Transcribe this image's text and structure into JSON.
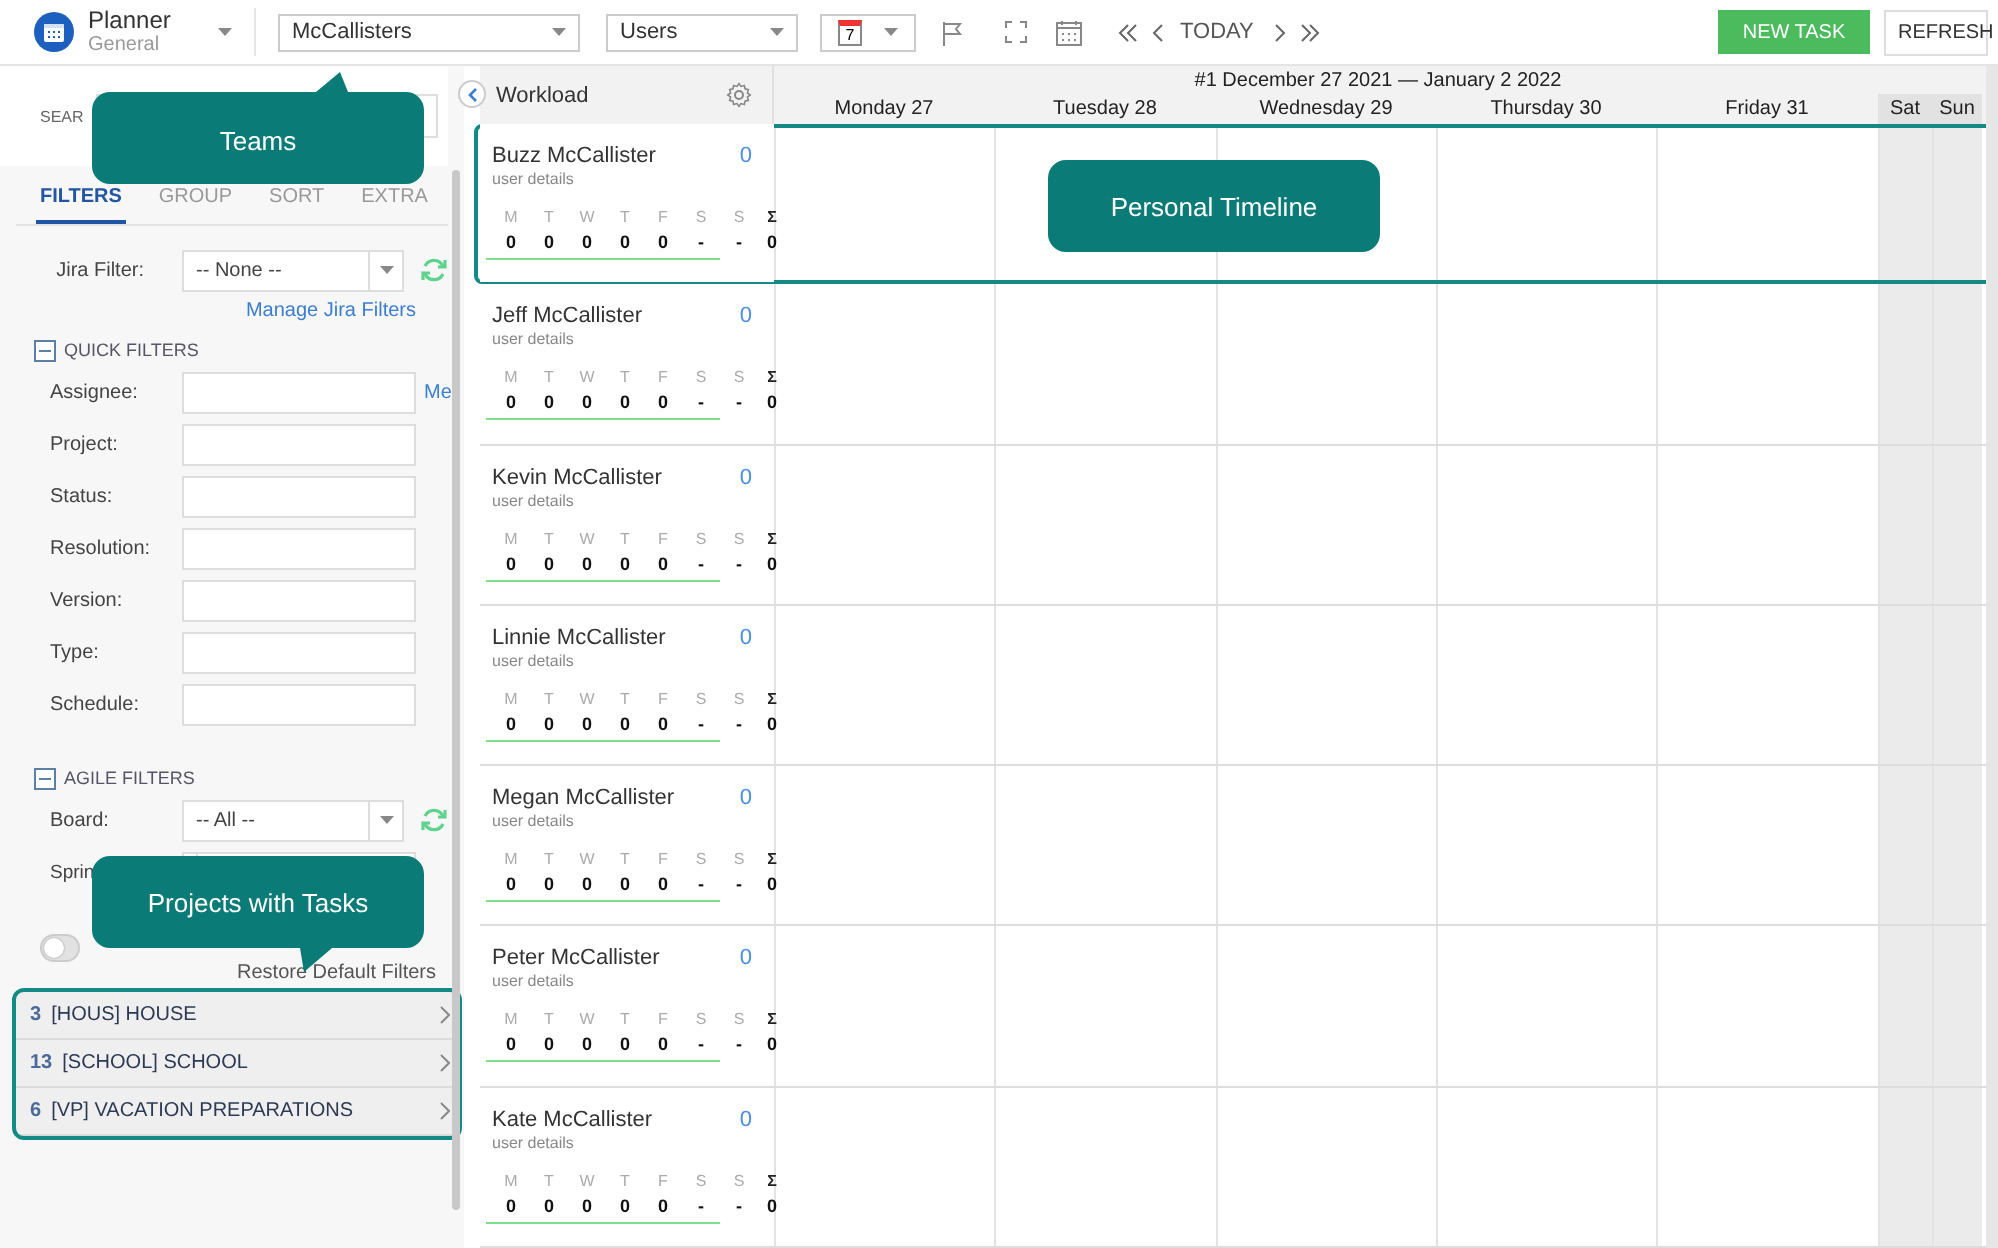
{
  "app": {
    "title": "Planner",
    "subtitle": "General"
  },
  "toolbar": {
    "team_select": "McCallisters",
    "view_select": "Users",
    "date_picker_day": "7",
    "today": "TODAY",
    "new_task": "NEW TASK",
    "refresh": "REFRESH"
  },
  "sidebar": {
    "search_label": "SEAR",
    "tabs": [
      {
        "label": "FILTERS",
        "selected": true
      },
      {
        "label": "GROUP",
        "selected": false
      },
      {
        "label": "SORT",
        "selected": false
      },
      {
        "label": "EXTRA",
        "selected": false
      }
    ],
    "jira_filter": {
      "label": "Jira Filter:",
      "value": "-- None --"
    },
    "manage_link": "Manage Jira Filters",
    "quick_filters": {
      "title": "QUICK FILTERS",
      "expanded": true,
      "me_link": "Me",
      "fields": [
        {
          "label": "Assignee:"
        },
        {
          "label": "Project:"
        },
        {
          "label": "Status:"
        },
        {
          "label": "Resolution:"
        },
        {
          "label": "Version:"
        },
        {
          "label": "Type:"
        },
        {
          "label": "Schedule:"
        }
      ]
    },
    "agile_filters": {
      "title": "AGILE FILTERS",
      "expanded": true,
      "board": {
        "label": "Board:",
        "value": "-- All --"
      },
      "sprint": {
        "label": "Sprin"
      }
    },
    "toggle": {
      "on": false
    },
    "restore_link": "Restore Default Filters",
    "projects": [
      {
        "count": "3",
        "name": "[HOUS] HOUSE"
      },
      {
        "count": "13",
        "name": "[SCHOOL] SCHOOL"
      },
      {
        "count": "6",
        "name": "[VP] VACATION PREPARATIONS"
      }
    ]
  },
  "timeline": {
    "workload_title": "Workload",
    "week_title": "#1 December 27 2021 — January 2 2022",
    "days": [
      {
        "label": "Monday 27",
        "weekend": false
      },
      {
        "label": "Tuesday 28",
        "weekend": false
      },
      {
        "label": "Wednesday 29",
        "weekend": false
      },
      {
        "label": "Thursday 30",
        "weekend": false
      },
      {
        "label": "Friday 31",
        "weekend": false
      },
      {
        "label": "Sat",
        "weekend": true
      },
      {
        "label": "Sun",
        "weekend": true
      }
    ],
    "users": [
      {
        "name": "Buzz McCallister",
        "count": "0",
        "details": "user details",
        "day_letters": [
          "M",
          "T",
          "W",
          "T",
          "F",
          "S",
          "S"
        ],
        "values": [
          "0",
          "0",
          "0",
          "0",
          "0",
          "-",
          "-"
        ],
        "sum_label": "Σ",
        "sum": "0"
      },
      {
        "name": "Jeff McCallister",
        "count": "0",
        "details": "user details",
        "day_letters": [
          "M",
          "T",
          "W",
          "T",
          "F",
          "S",
          "S"
        ],
        "values": [
          "0",
          "0",
          "0",
          "0",
          "0",
          "-",
          "-"
        ],
        "sum_label": "Σ",
        "sum": "0"
      },
      {
        "name": "Kevin McCallister",
        "count": "0",
        "details": "user details",
        "day_letters": [
          "M",
          "T",
          "W",
          "T",
          "F",
          "S",
          "S"
        ],
        "values": [
          "0",
          "0",
          "0",
          "0",
          "0",
          "-",
          "-"
        ],
        "sum_label": "Σ",
        "sum": "0"
      },
      {
        "name": "Linnie McCallister",
        "count": "0",
        "details": "user details",
        "day_letters": [
          "M",
          "T",
          "W",
          "T",
          "F",
          "S",
          "S"
        ],
        "values": [
          "0",
          "0",
          "0",
          "0",
          "0",
          "-",
          "-"
        ],
        "sum_label": "Σ",
        "sum": "0"
      },
      {
        "name": "Megan McCallister",
        "count": "0",
        "details": "user details",
        "day_letters": [
          "M",
          "T",
          "W",
          "T",
          "F",
          "S",
          "S"
        ],
        "values": [
          "0",
          "0",
          "0",
          "0",
          "0",
          "-",
          "-"
        ],
        "sum_label": "Σ",
        "sum": "0"
      },
      {
        "name": "Peter McCallister",
        "count": "0",
        "details": "user details",
        "day_letters": [
          "M",
          "T",
          "W",
          "T",
          "F",
          "S",
          "S"
        ],
        "values": [
          "0",
          "0",
          "0",
          "0",
          "0",
          "-",
          "-"
        ],
        "sum_label": "Σ",
        "sum": "0"
      },
      {
        "name": "Kate McCallister",
        "count": "0",
        "details": "user details",
        "day_letters": [
          "M",
          "T",
          "W",
          "T",
          "F",
          "S",
          "S"
        ],
        "values": [
          "0",
          "0",
          "0",
          "0",
          "0",
          "-",
          "-"
        ],
        "sum_label": "Σ",
        "sum": "0"
      }
    ]
  },
  "callouts": [
    {
      "text": "Teams",
      "kind": "tail-up"
    },
    {
      "text": "Personal Timeline",
      "kind": "plain"
    },
    {
      "text": "Projects with Tasks",
      "kind": "tail-down"
    }
  ]
}
